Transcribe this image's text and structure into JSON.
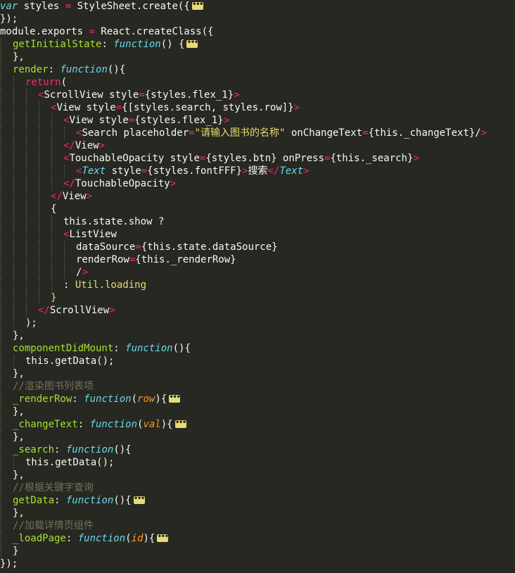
{
  "editor": {
    "background": "#272822",
    "lines": [
      {
        "indent": 0,
        "tokens": [
          [
            "kw-i",
            "var"
          ],
          [
            "t",
            " styles "
          ],
          [
            "kw",
            "="
          ],
          [
            "t",
            " StyleSheet.create({"
          ],
          [
            "fold",
            ""
          ]
        ]
      },
      {
        "indent": 0,
        "tokens": [
          [
            "t",
            "});"
          ]
        ]
      },
      {
        "indent": 0,
        "tokens": [
          [
            "t",
            "module.exports "
          ],
          [
            "kw",
            "="
          ],
          [
            "t",
            " React.createClass({"
          ]
        ]
      },
      {
        "indent": 1,
        "tokens": [
          [
            "prop",
            "getInitialState"
          ],
          [
            "t",
            ": "
          ],
          [
            "fn",
            "function"
          ],
          [
            "t",
            "() {"
          ],
          [
            "fold",
            ""
          ]
        ]
      },
      {
        "indent": 1,
        "tokens": [
          [
            "t",
            "},"
          ]
        ]
      },
      {
        "indent": 1,
        "tokens": [
          [
            "prop",
            "render"
          ],
          [
            "t",
            ": "
          ],
          [
            "fn",
            "function"
          ],
          [
            "t",
            "(){"
          ]
        ]
      },
      {
        "indent": 2,
        "tokens": [
          [
            "kw",
            "return"
          ],
          [
            "t",
            "("
          ]
        ]
      },
      {
        "indent": 3,
        "tokens": [
          [
            "tag",
            "<"
          ],
          [
            "t",
            "ScrollView style"
          ],
          [
            "kw",
            "="
          ],
          [
            "t",
            "{styles.flex_1}"
          ],
          [
            "tag",
            ">"
          ]
        ]
      },
      {
        "indent": 4,
        "tokens": [
          [
            "tag",
            "<"
          ],
          [
            "t",
            "View style"
          ],
          [
            "kw",
            "="
          ],
          [
            "t",
            "{[styles.search, styles.row]}"
          ],
          [
            "tag",
            ">"
          ]
        ]
      },
      {
        "indent": 5,
        "tokens": [
          [
            "tag",
            "<"
          ],
          [
            "t",
            "View style"
          ],
          [
            "kw",
            "="
          ],
          [
            "t",
            "{styles.flex_1}"
          ],
          [
            "tag",
            ">"
          ]
        ]
      },
      {
        "indent": 6,
        "tokens": [
          [
            "tag",
            "<"
          ],
          [
            "t",
            "Search placeholder"
          ],
          [
            "kw",
            "="
          ],
          [
            "str",
            "\"请输入图书的名称\""
          ],
          [
            "t",
            " onChangeText"
          ],
          [
            "kw",
            "="
          ],
          [
            "t",
            "{this._changeText}/"
          ],
          [
            "tag",
            ">"
          ]
        ]
      },
      {
        "indent": 5,
        "tokens": [
          [
            "tag",
            "</"
          ],
          [
            "t",
            "View"
          ],
          [
            "tag",
            ">"
          ]
        ]
      },
      {
        "indent": 5,
        "tokens": [
          [
            "tag",
            "<"
          ],
          [
            "t",
            "TouchableOpacity style"
          ],
          [
            "kw",
            "="
          ],
          [
            "t",
            "{styles.btn} onPress"
          ],
          [
            "kw",
            "="
          ],
          [
            "t",
            "{this._search}"
          ],
          [
            "tag",
            ">"
          ]
        ]
      },
      {
        "indent": 6,
        "tokens": [
          [
            "tag",
            "<"
          ],
          [
            "fn",
            "Text"
          ],
          [
            "t",
            " style"
          ],
          [
            "kw",
            "="
          ],
          [
            "t",
            "{styles.fontFFF}"
          ],
          [
            "tag",
            ">"
          ],
          [
            "t",
            "搜索"
          ],
          [
            "tag",
            "</"
          ],
          [
            "fn",
            "Text"
          ],
          [
            "tag",
            ">"
          ]
        ]
      },
      {
        "indent": 5,
        "tokens": [
          [
            "tag",
            "</"
          ],
          [
            "t",
            "TouchableOpacity"
          ],
          [
            "tag",
            ">"
          ]
        ]
      },
      {
        "indent": 4,
        "tokens": [
          [
            "tag",
            "</"
          ],
          [
            "t",
            "View"
          ],
          [
            "tag",
            ">"
          ]
        ]
      },
      {
        "indent": 4,
        "tokens": [
          [
            "t",
            "{"
          ]
        ]
      },
      {
        "indent": 5,
        "tokens": [
          [
            "t",
            "this.state.show ?"
          ]
        ]
      },
      {
        "indent": 5,
        "tokens": [
          [
            "tag",
            "<"
          ],
          [
            "t",
            "ListView"
          ]
        ]
      },
      {
        "indent": 6,
        "tokens": [
          [
            "t",
            "dataSource"
          ],
          [
            "kw",
            "="
          ],
          [
            "t",
            "{this.state.dataSource}"
          ]
        ]
      },
      {
        "indent": 6,
        "tokens": [
          [
            "t",
            "renderRow"
          ],
          [
            "kw",
            "="
          ],
          [
            "t",
            "{this._renderRow}"
          ]
        ]
      },
      {
        "indent": 6,
        "tokens": [
          [
            "t",
            "/"
          ],
          [
            "tag",
            ">"
          ]
        ]
      },
      {
        "indent": 5,
        "tokens": [
          [
            "t",
            ": "
          ],
          [
            "prop-y",
            "Util.loading"
          ]
        ]
      },
      {
        "indent": 4,
        "tokens": [
          [
            "prop-y",
            "}"
          ]
        ]
      },
      {
        "indent": 3,
        "tokens": [
          [
            "tag",
            "</"
          ],
          [
            "t",
            "ScrollView"
          ],
          [
            "tag",
            ">"
          ]
        ]
      },
      {
        "indent": 2,
        "tokens": [
          [
            "t",
            ");"
          ]
        ]
      },
      {
        "indent": 1,
        "tokens": [
          [
            "t",
            "},"
          ]
        ]
      },
      {
        "indent": 1,
        "tokens": [
          [
            "prop",
            "componentDidMount"
          ],
          [
            "t",
            ": "
          ],
          [
            "fn",
            "function"
          ],
          [
            "t",
            "(){"
          ]
        ]
      },
      {
        "indent": 2,
        "tokens": [
          [
            "t",
            "this.getData();"
          ]
        ]
      },
      {
        "indent": 1,
        "tokens": [
          [
            "t",
            "},"
          ]
        ]
      },
      {
        "indent": 1,
        "tokens": [
          [
            "cm",
            "//渲染图书列表项"
          ]
        ]
      },
      {
        "indent": 1,
        "tokens": [
          [
            "prop",
            "_renderRow"
          ],
          [
            "t",
            ": "
          ],
          [
            "fn",
            "function"
          ],
          [
            "t",
            "("
          ],
          [
            "param",
            "row"
          ],
          [
            "t",
            "){"
          ],
          [
            "fold",
            ""
          ]
        ]
      },
      {
        "indent": 1,
        "tokens": [
          [
            "t",
            "},"
          ]
        ]
      },
      {
        "indent": 1,
        "tokens": [
          [
            "prop",
            "_changeText"
          ],
          [
            "t",
            ": "
          ],
          [
            "fn",
            "function"
          ],
          [
            "t",
            "("
          ],
          [
            "param",
            "val"
          ],
          [
            "t",
            "){"
          ],
          [
            "fold",
            ""
          ]
        ]
      },
      {
        "indent": 1,
        "tokens": [
          [
            "t",
            "},"
          ]
        ]
      },
      {
        "indent": 1,
        "tokens": [
          [
            "prop",
            "_search"
          ],
          [
            "t",
            ": "
          ],
          [
            "fn",
            "function"
          ],
          [
            "t",
            "(){"
          ]
        ]
      },
      {
        "indent": 2,
        "tokens": [
          [
            "t",
            "this.getData();"
          ]
        ]
      },
      {
        "indent": 1,
        "tokens": [
          [
            "t",
            "},"
          ]
        ]
      },
      {
        "indent": 1,
        "tokens": [
          [
            "cm",
            "//根据关键字查询"
          ]
        ]
      },
      {
        "indent": 1,
        "tokens": [
          [
            "prop",
            "getData"
          ],
          [
            "t",
            ": "
          ],
          [
            "fn",
            "function"
          ],
          [
            "t",
            "(){"
          ],
          [
            "fold",
            ""
          ]
        ]
      },
      {
        "indent": 1,
        "tokens": [
          [
            "t",
            "},"
          ]
        ]
      },
      {
        "indent": 1,
        "tokens": [
          [
            "cm",
            "//加载详情页组件"
          ]
        ]
      },
      {
        "indent": 1,
        "tokens": [
          [
            "prop",
            "_loadPage"
          ],
          [
            "t",
            ": "
          ],
          [
            "fn",
            "function"
          ],
          [
            "t",
            "("
          ],
          [
            "param",
            "id"
          ],
          [
            "t",
            "){"
          ],
          [
            "fold",
            ""
          ]
        ]
      },
      {
        "indent": 1,
        "tokens": [
          [
            "t",
            "}"
          ]
        ]
      },
      {
        "indent": 0,
        "tokens": [
          [
            "t",
            "});"
          ]
        ]
      }
    ]
  }
}
